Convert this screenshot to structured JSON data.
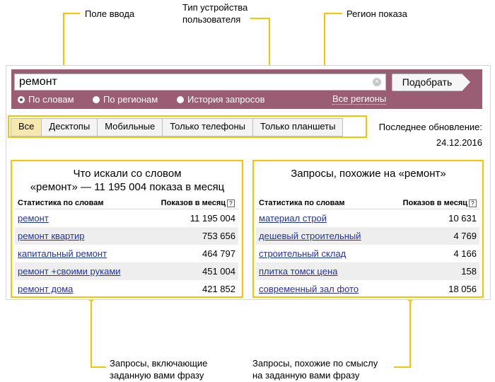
{
  "callouts": {
    "input_field": "Поле ввода",
    "device_type_line1": "Тип устройства",
    "device_type_line2": "пользователя",
    "region": "Регион показа",
    "including_line1": "Запросы, включающие",
    "including_line2": "заданную вами фразу",
    "similar_line1": "Запросы, похожие по смыслу",
    "similar_line2": "на заданную вами фразу"
  },
  "search": {
    "value": "ремонт",
    "submit_label": "Подобрать"
  },
  "modes": [
    {
      "label": "По словам",
      "selected": true
    },
    {
      "label": "По регионам",
      "selected": false
    },
    {
      "label": "История запросов",
      "selected": false
    }
  ],
  "region_link": "Все регионы",
  "device_tabs": [
    {
      "label": "Все",
      "active": true
    },
    {
      "label": "Десктопы",
      "active": false
    },
    {
      "label": "Мобильные",
      "active": false
    },
    {
      "label": "Только телефоны",
      "active": false
    },
    {
      "label": "Только планшеты",
      "active": false
    }
  ],
  "last_update": {
    "label": "Последнее обновление:",
    "date": "24.12.2016"
  },
  "left_panel": {
    "title_line1": "Что искали со словом",
    "title_line2": "«ремонт» — 11 195 004 показа в месяц",
    "col1": "Статистика по словам",
    "col2": "Показов в месяц",
    "rows": [
      {
        "phrase": "ремонт",
        "count": "11 195 004"
      },
      {
        "phrase": "ремонт квартир",
        "count": "753 656"
      },
      {
        "phrase": "капитальный ремонт",
        "count": "464 797"
      },
      {
        "phrase": "ремонт +своими руками",
        "count": "451 004"
      },
      {
        "phrase": "ремонт дома",
        "count": "421 852"
      }
    ]
  },
  "right_panel": {
    "title": "Запросы, похожие на «ремонт»",
    "col1": "Статистика по словам",
    "col2": "Показов в месяц",
    "rows": [
      {
        "phrase": "материал строй",
        "count": "10 631"
      },
      {
        "phrase": "дешевый строительный",
        "count": "4 769"
      },
      {
        "phrase": "строительный склад",
        "count": "4 166"
      },
      {
        "phrase": "плитка томск цена",
        "count": "158"
      },
      {
        "phrase": "современный зал фото",
        "count": "18 056"
      }
    ]
  },
  "colors": {
    "accent": "#f5c500",
    "bar": "#9a5d73",
    "link": "#2133a6",
    "active_tab": "#f7e9ad"
  }
}
